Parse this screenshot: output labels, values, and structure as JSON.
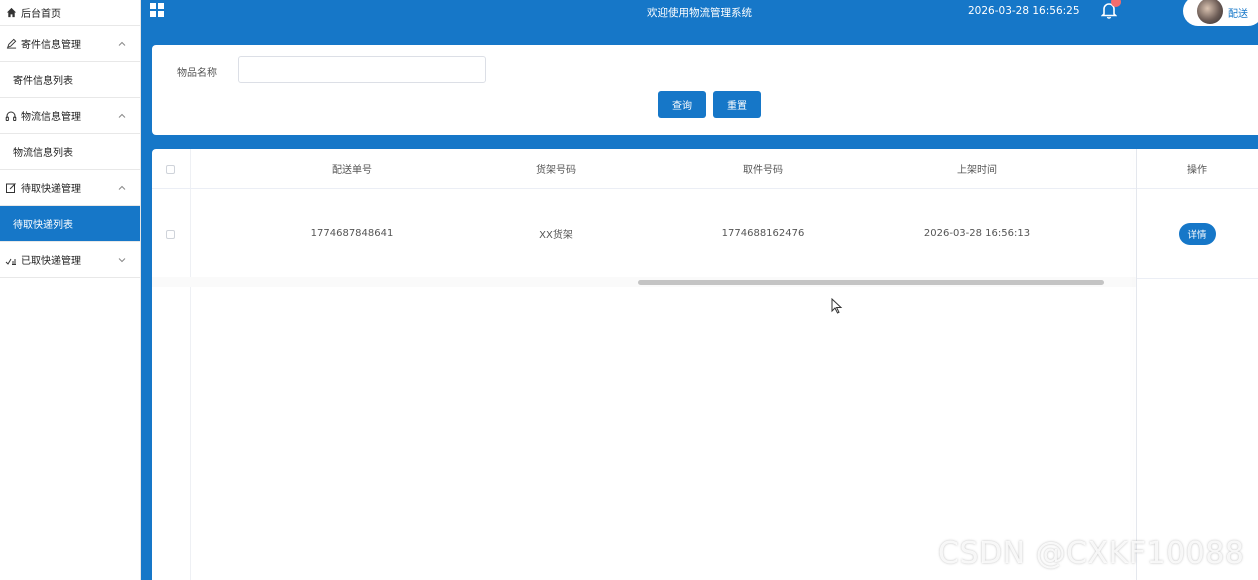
{
  "sidebar": {
    "home": "后台首页",
    "groups": [
      {
        "label": "寄件信息管理",
        "sub": "寄件信息列表"
      },
      {
        "label": "物流信息管理",
        "sub": "物流信息列表"
      },
      {
        "label": "待取快递管理",
        "sub": "待取快递列表"
      },
      {
        "label": "已取快递管理"
      }
    ]
  },
  "topbar": {
    "title": "欢迎使用物流管理系统",
    "datetime": "2026-03-28 16:56:25",
    "user": "配送"
  },
  "search": {
    "label": "物品名称",
    "placeholder": "",
    "query_label": "查询",
    "reset_label": "重置"
  },
  "table": {
    "headers": [
      "配送单号",
      "货架号码",
      "取件号码",
      "上架时间",
      "操作"
    ],
    "rows": [
      {
        "order_no": "1774687848641",
        "shelf": "XX货架",
        "pickup": "1774688162476",
        "time": "2026-03-28 16:56:13",
        "action": "详情"
      }
    ]
  },
  "watermark": "CSDN @CXKF10088",
  "colors": {
    "primary": "#1677c8",
    "badge": "#f56c6c"
  }
}
